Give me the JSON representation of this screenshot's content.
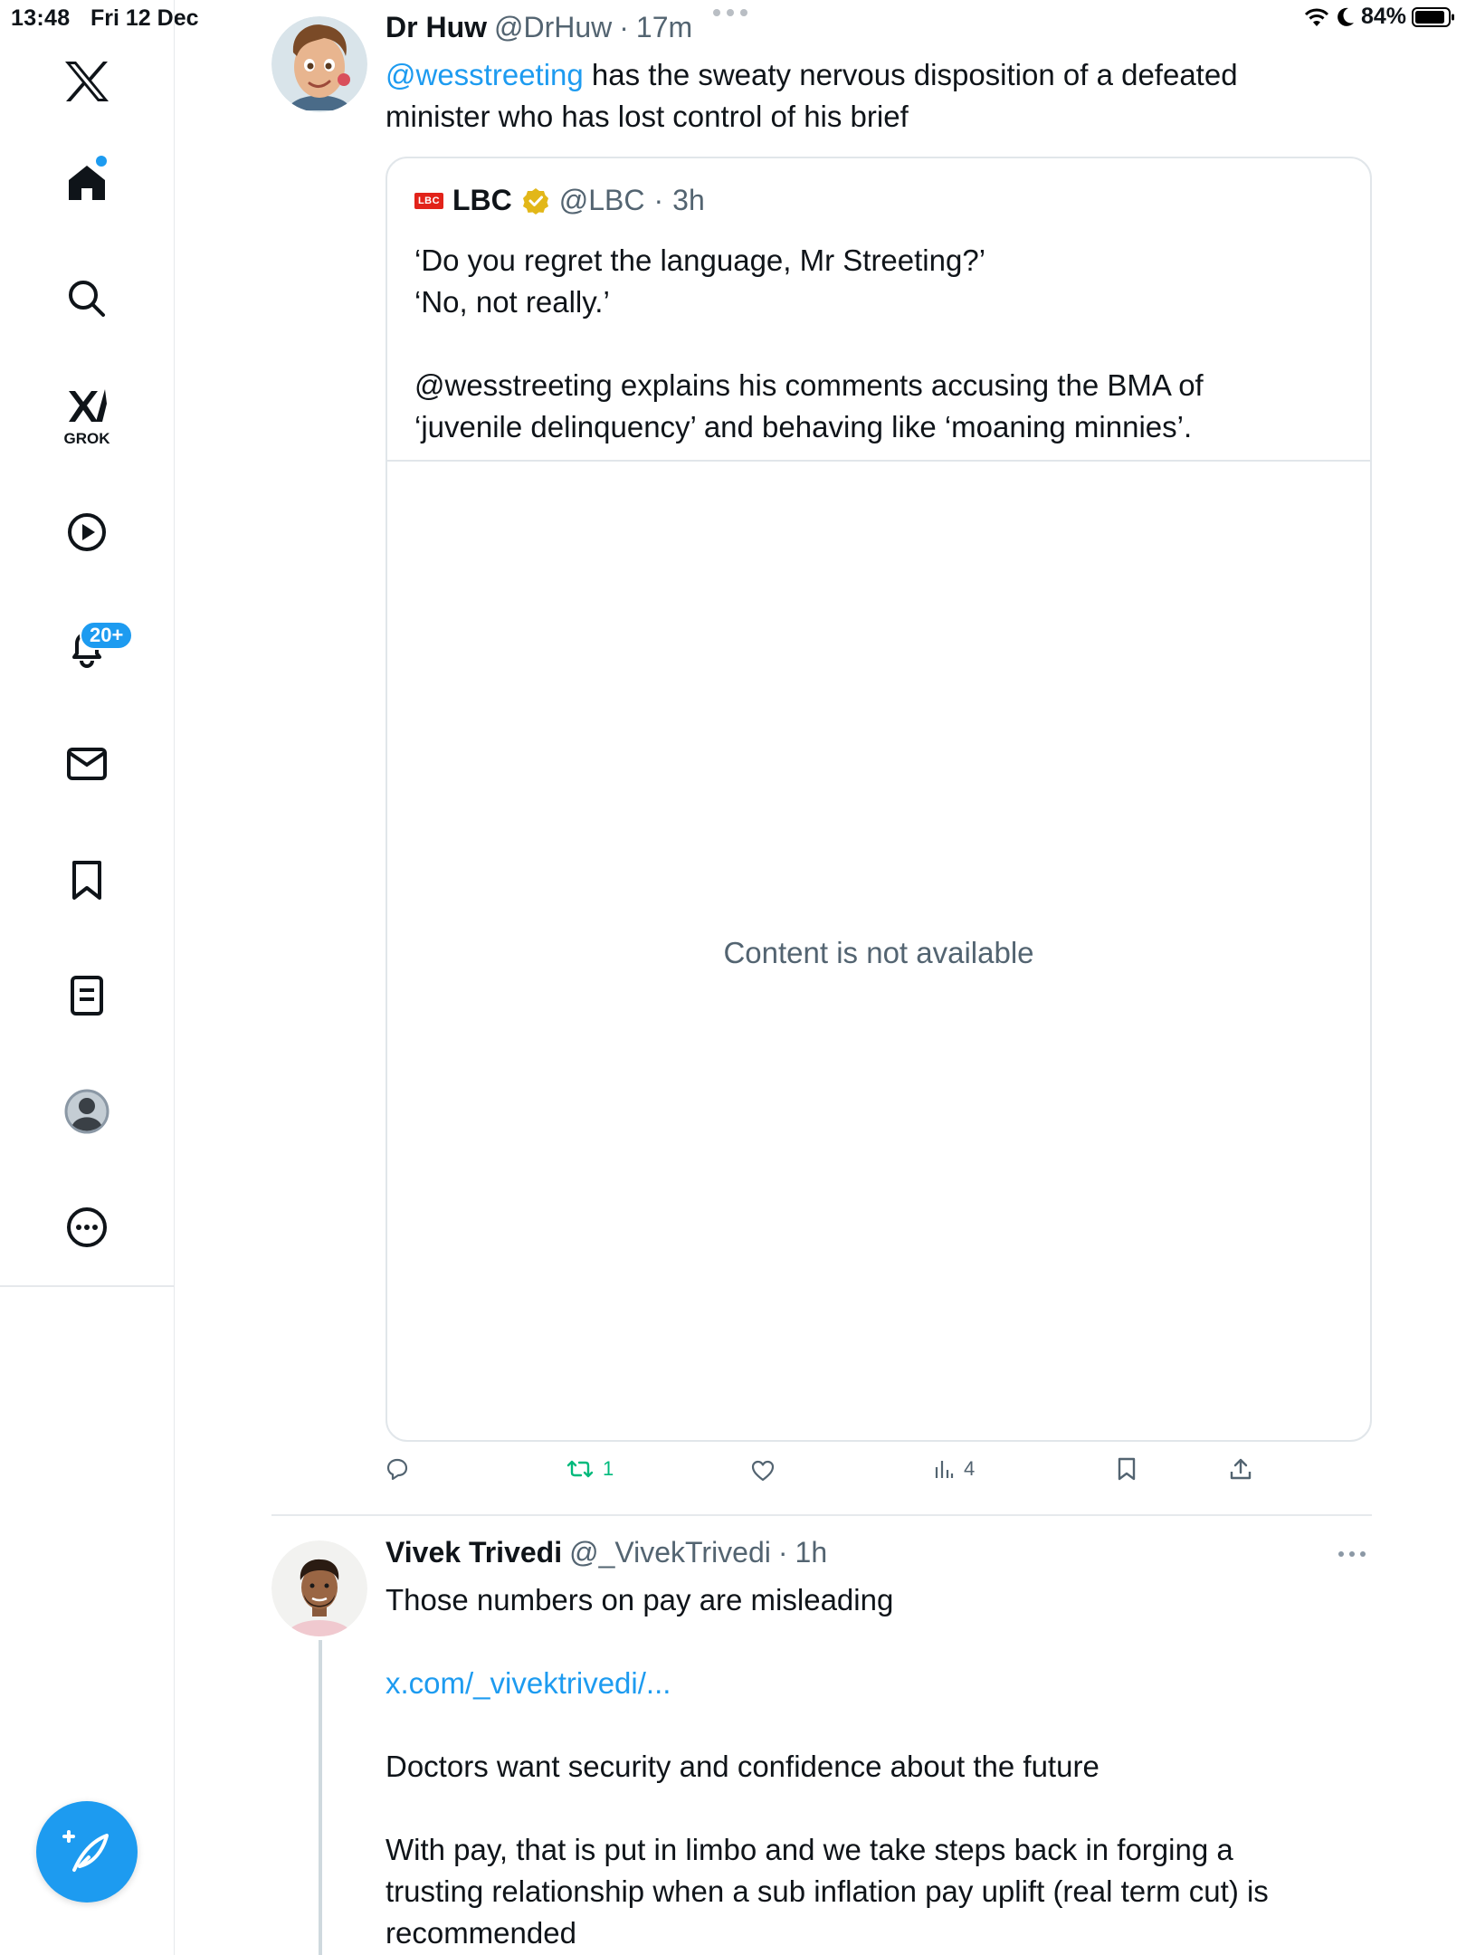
{
  "status_bar": {
    "time": "13:48",
    "date": "Fri 12 Dec",
    "battery": "84%"
  },
  "sidebar": {
    "grok_label": "GROK",
    "notifications_badge": "20+",
    "items": [
      "x-logo",
      "home-icon",
      "search-icon",
      "grok-icon",
      "video-icon",
      "bell-icon",
      "mail-icon",
      "bookmark-icon",
      "lists-icon",
      "profile-icon",
      "more-icon"
    ]
  },
  "tweet1": {
    "name": "Dr Huw",
    "handle": "@DrHuw",
    "sep": "·",
    "time": "17m",
    "mention": "@wesstreeting",
    "text_line1": " has the sweaty nervous disposition of a defeated",
    "text_line2": "minister who has lost control of his brief",
    "quote": {
      "logo_text": "LBC",
      "name": "LBC",
      "handle": "@LBC",
      "sep": "·",
      "time": "3h",
      "line1": "‘Do you regret the language, Mr Streeting?’",
      "line2": "‘No, not really.’",
      "line3": "@wesstreeting explains his comments accusing the BMA of",
      "line4": "‘juvenile delinquency’ and behaving like ‘moaning minnies’.",
      "media_message": "Content is not available"
    },
    "actions": {
      "reply_count": "",
      "retweet_count": "1",
      "like_count": "",
      "views_count": "4"
    }
  },
  "tweet2": {
    "name": "Vivek Trivedi",
    "handle": "@_VivekTrivedi",
    "sep": "·",
    "time": "1h",
    "line1": "Those numbers on pay are misleading",
    "link": "x.com/_vivektrivedi/...",
    "line2": "Doctors want security and confidence about the future",
    "line3": "With pay, that is put in limbo and we take steps back in forging a",
    "line4": "trusting relationship when a sub inflation pay uplift (real term cut) is",
    "line5": "recommended"
  },
  "colors": {
    "accent": "#1d9bf0",
    "retweet": "#00ba7c",
    "secondary_text": "#536471",
    "border": "#e1e6ea"
  }
}
